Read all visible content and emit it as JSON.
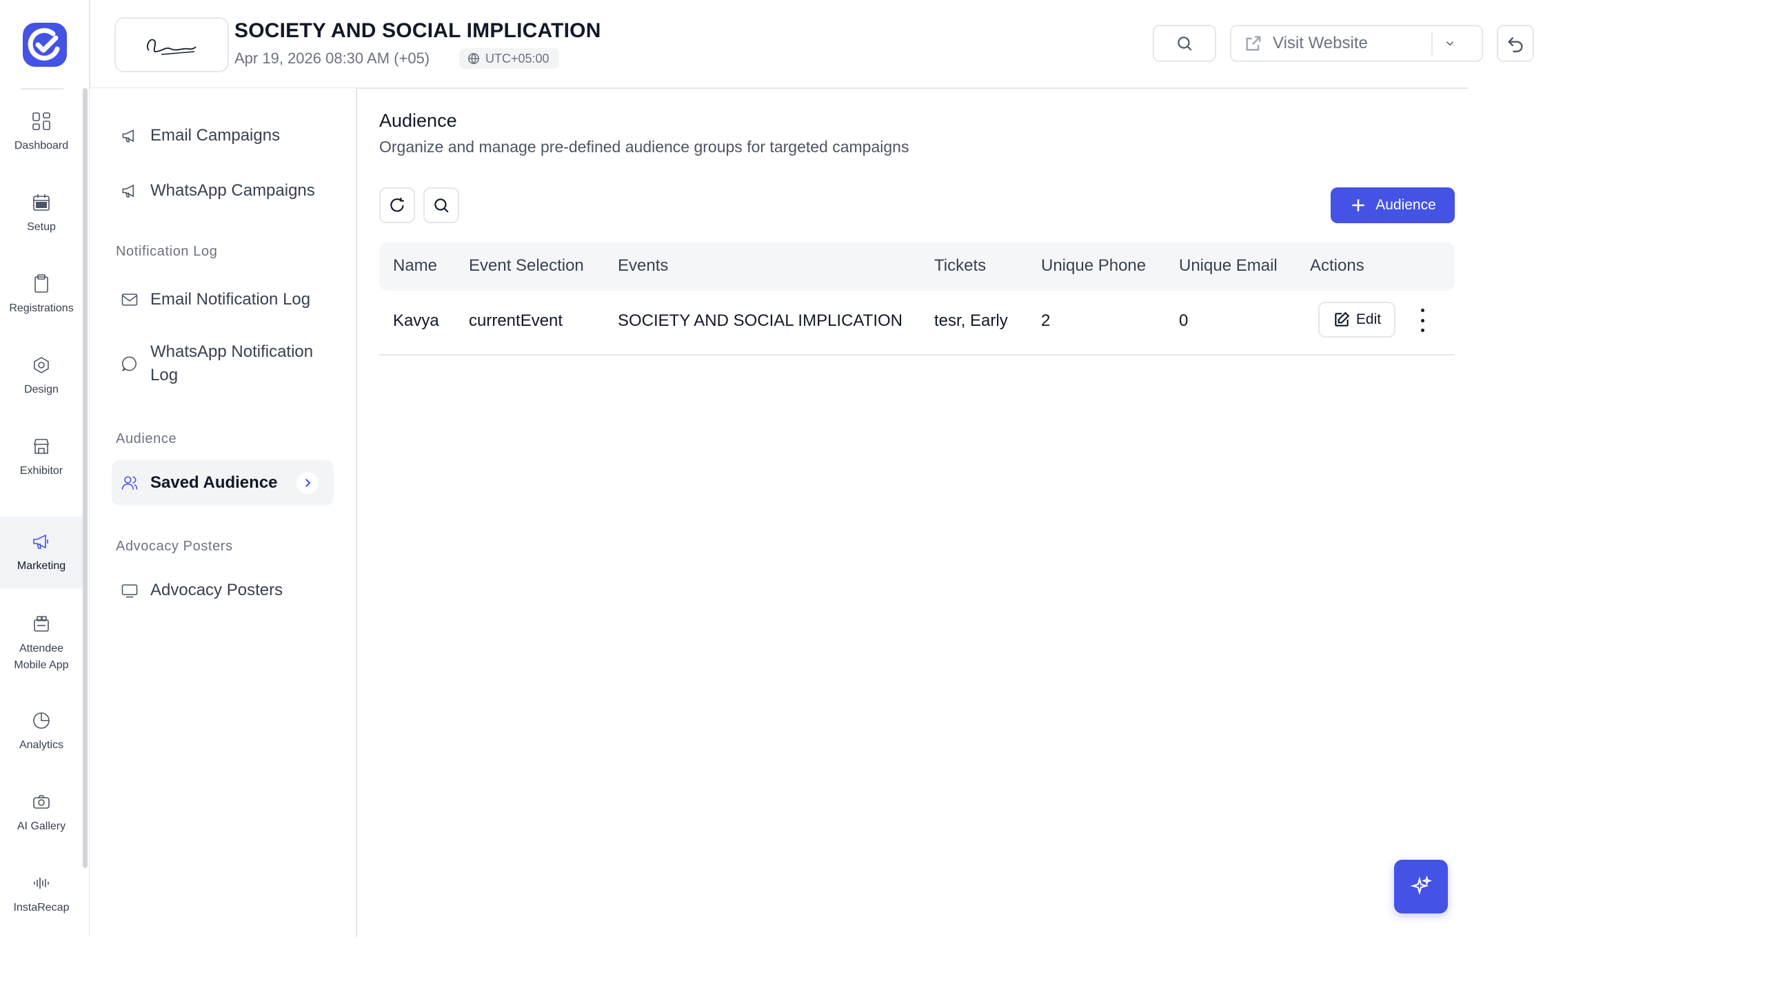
{
  "header": {
    "event_title": "SOCIETY AND SOCIAL IMPLICATION",
    "event_date": "Apr 19, 2026 08:30 AM (+05)",
    "timezone": "UTC+05:00",
    "visit_website": "Visit Website"
  },
  "rail": {
    "items": [
      {
        "label": "Dashboard",
        "icon": "grid-icon"
      },
      {
        "label": "Setup",
        "icon": "calendar-icon"
      },
      {
        "label": "Registrations",
        "icon": "clipboard-icon"
      },
      {
        "label": "Design",
        "icon": "hexagon-icon"
      },
      {
        "label": "Exhibitor",
        "icon": "store-icon"
      },
      {
        "label": "Marketing",
        "icon": "megaphone-icon",
        "active": true
      },
      {
        "label": "Attendee Mobile App",
        "icon": "app-icon"
      },
      {
        "label": "Analytics",
        "icon": "pie-icon"
      },
      {
        "label": "AI Gallery",
        "icon": "camera-icon"
      },
      {
        "label": "InstaRecap",
        "icon": "audio-icon"
      }
    ]
  },
  "subnav": {
    "email_campaigns": "Email Campaigns",
    "whatsapp_campaigns": "WhatsApp Campaigns",
    "section_notification_log": "Notification Log",
    "email_notification_log": "Email Notification Log",
    "whatsapp_notification_log": "WhatsApp Notification Log",
    "section_audience": "Audience",
    "saved_audience": "Saved Audience",
    "section_advocacy": "Advocacy Posters",
    "advocacy_posters": "Advocacy Posters"
  },
  "main": {
    "title": "Audience",
    "subtitle": "Organize and manage pre-defined audience groups for targeted campaigns",
    "add_button": "Audience",
    "columns": [
      "Name",
      "Event Selection",
      "Events",
      "Tickets",
      "Unique Phone",
      "Unique Email",
      "Actions"
    ],
    "rows": [
      {
        "name": "Kavya",
        "event_selection": "currentEvent",
        "events": "SOCIETY AND SOCIAL IMPLICATION",
        "tickets": "tesr, Early",
        "unique_phone": "2",
        "unique_email": "0",
        "edit": "Edit"
      }
    ]
  },
  "colors": {
    "accent": "#4452e6",
    "border": "#e5e7eb",
    "header_bg": "#f5f6f8"
  }
}
